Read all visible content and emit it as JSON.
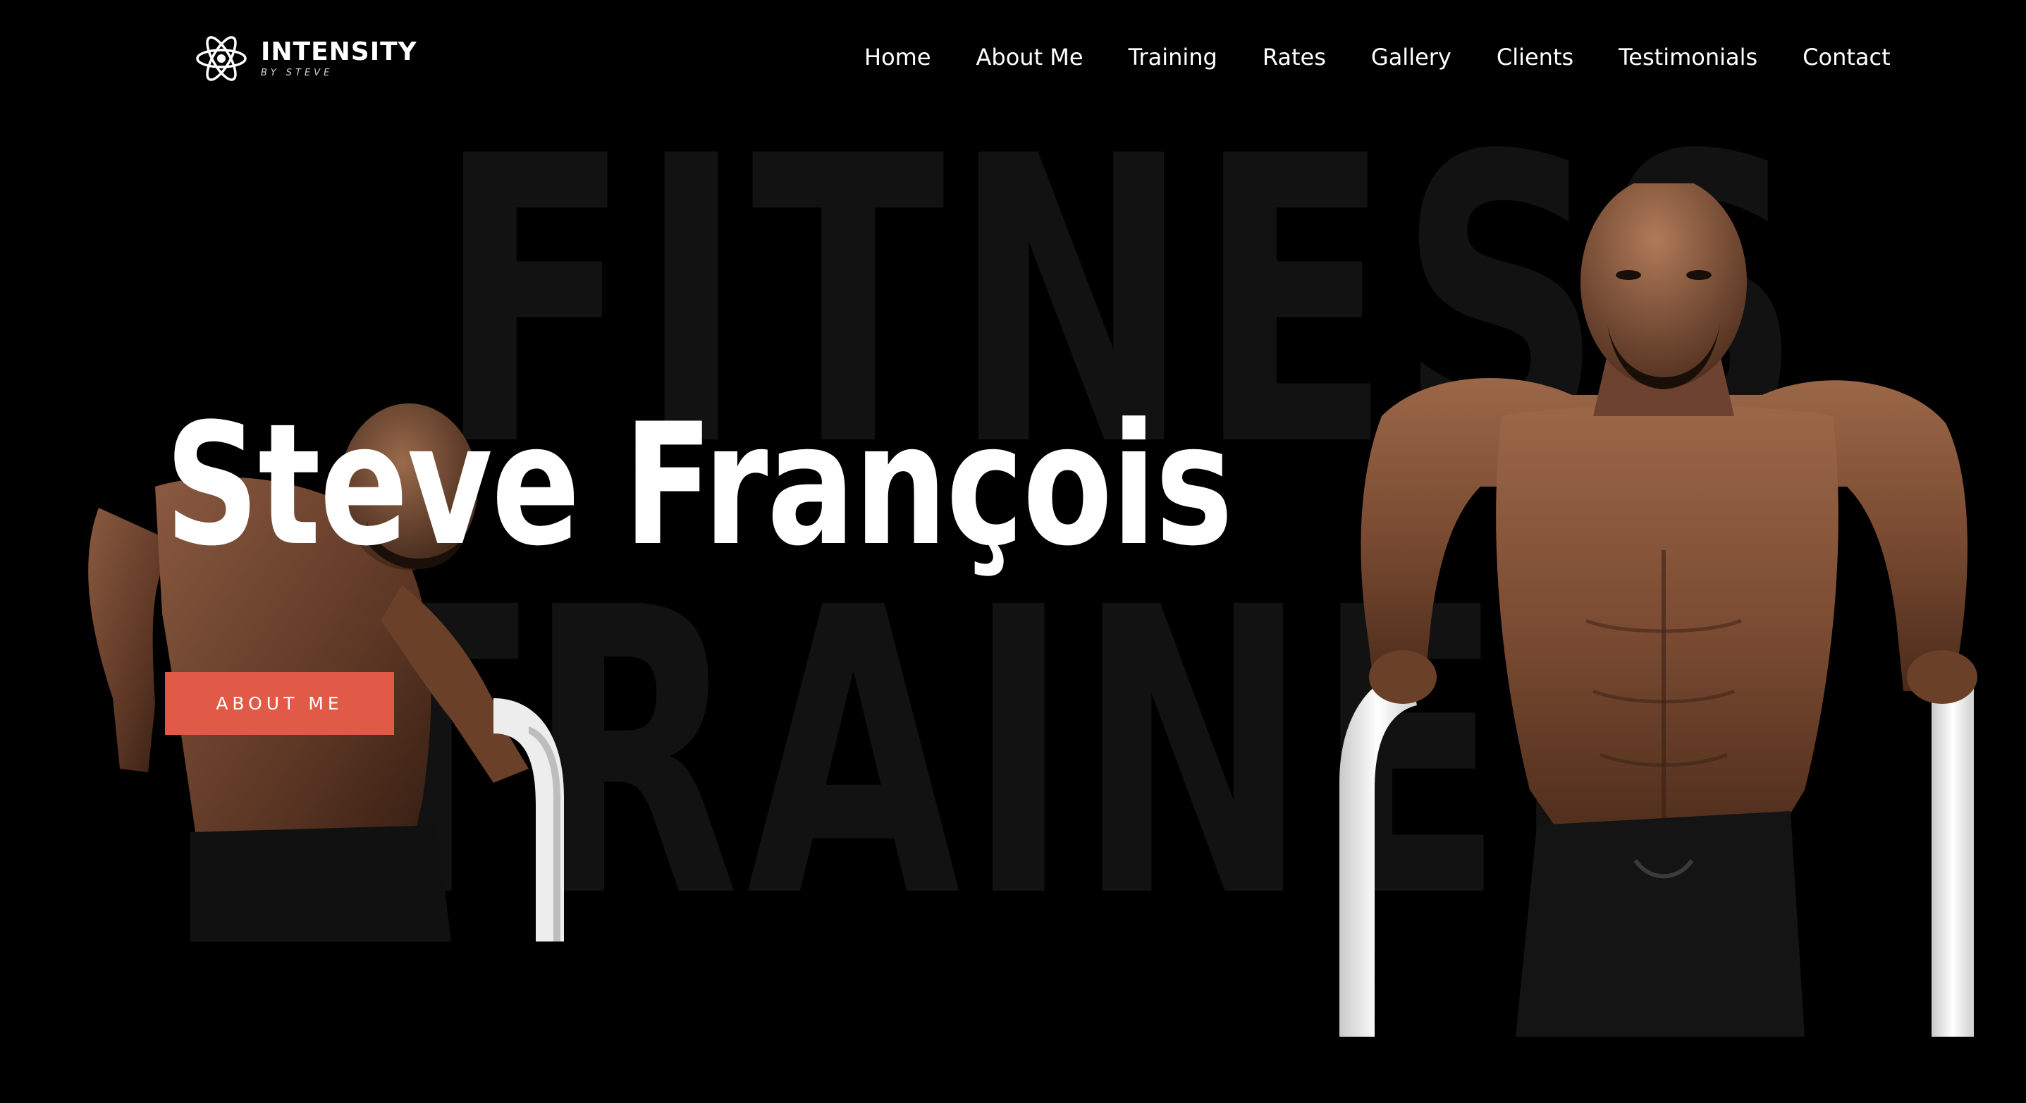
{
  "brand": {
    "name": "INTENSITY",
    "tagline": "BY STEVE",
    "icon": "atom-icon"
  },
  "nav": {
    "items": [
      {
        "label": "Home"
      },
      {
        "label": "About Me"
      },
      {
        "label": "Training"
      },
      {
        "label": "Rates"
      },
      {
        "label": "Gallery"
      },
      {
        "label": "Clients"
      },
      {
        "label": "Testimonials"
      },
      {
        "label": "Contact"
      }
    ]
  },
  "hero": {
    "background_words": [
      "FITNESS",
      "TRAINER"
    ],
    "name": "Steve François",
    "cta_label": "ABOUT ME"
  },
  "colors": {
    "background": "#000000",
    "accent": "#e05a47",
    "background_text": "#121212",
    "text": "#ffffff"
  }
}
